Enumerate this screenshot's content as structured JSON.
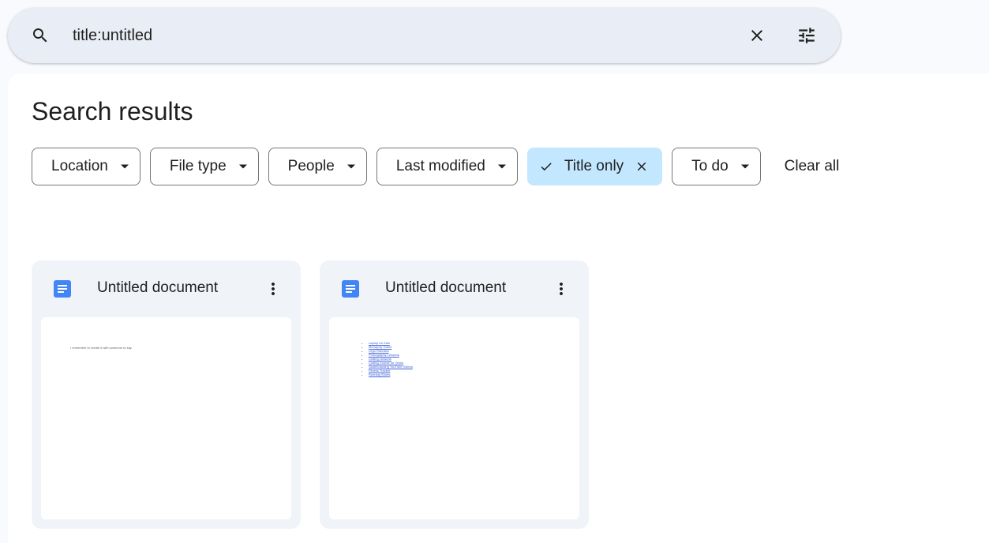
{
  "search": {
    "query": "title:untitled"
  },
  "page": {
    "title": "Search results"
  },
  "filters": {
    "location": "Location",
    "file_type": "File type",
    "people": "People",
    "last_modified": "Last modified",
    "title_only": "Title only",
    "to_do": "To do",
    "clear_all": "Clear all"
  },
  "cards": [
    {
      "title": "Untitled document",
      "preview_line": "I remember to create it with someone to say"
    },
    {
      "title": "Untitled document",
      "preview_items": [
        "Laptop for Kids",
        "Monopoly Game",
        "Lego Robotics",
        "Photography Lessons",
        "Coding Lessons",
        "Coding Course for Teens",
        "Skateboarding YouTube Videos",
        "Fitness Tracker",
        "Running Shoes"
      ]
    }
  ],
  "colors": {
    "background": "#f8fafd",
    "search_bar": "#e9eef6",
    "active_chip": "#c2e7ff",
    "card": "#f0f4f9",
    "doc_icon": "#4285f4"
  },
  "icons": {
    "search": "search-icon",
    "clear": "close-icon",
    "tune": "tune-icon",
    "caret": "arrow-drop-down-icon",
    "check": "check-icon",
    "doc": "google-docs-icon",
    "more": "more-vert-icon"
  }
}
